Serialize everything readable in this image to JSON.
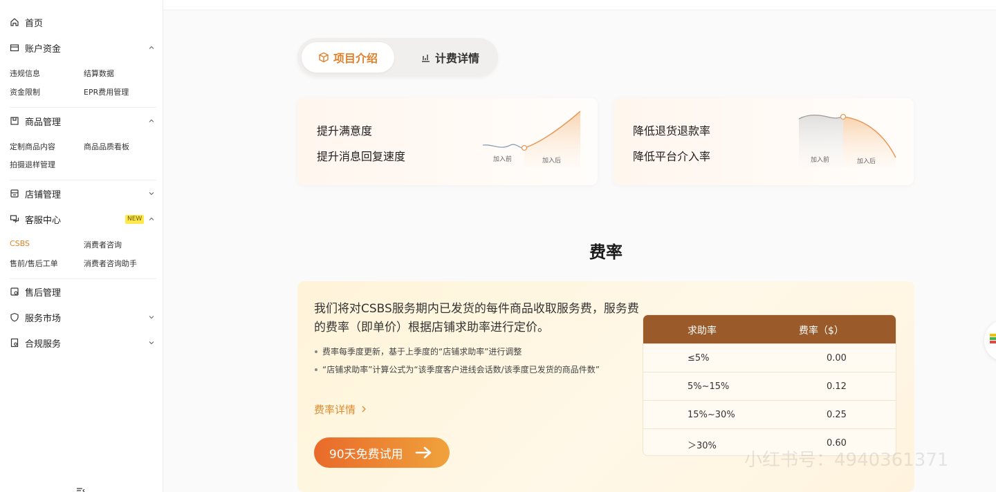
{
  "sidebar": {
    "home": "首页",
    "account": {
      "label": "账户资金",
      "items": [
        "违规信息",
        "结算数据",
        "资金限制",
        "EPR费用管理"
      ]
    },
    "goods": {
      "label": "商品管理",
      "items": [
        "定制商品内容",
        "商品品质看板",
        "拍摄退样管理"
      ]
    },
    "shop": {
      "label": "店铺管理"
    },
    "service": {
      "label": "客服中心",
      "badge": "NEW",
      "items": [
        "CSBS",
        "消费者咨询",
        "售前/售后工单",
        "消费者咨询助手"
      ]
    },
    "after_sales": {
      "label": "售后管理"
    },
    "market": {
      "label": "服务市场"
    },
    "compliance": {
      "label": "合规服务"
    }
  },
  "tabs": {
    "intro": "项目介绍",
    "billing": "计费详情"
  },
  "cards": [
    {
      "line1": "提升满意度",
      "line2": "提升消息回复速度",
      "before": "加入前",
      "after": "加入后"
    },
    {
      "line1": "降低退货退款率",
      "line2": "降低平台介入率",
      "before": "加入前",
      "after": "加入后"
    }
  ],
  "rate": {
    "title": "费率",
    "desc": "我们将对CSBS服务期内已发货的每件商品收取服务费，服务费的费率（即单价）根据店铺求助率进行定价。",
    "bullets": [
      "费率每季度更新，基于上季度的“店铺求助率”进行调整",
      "“店铺求助率”计算公式为“该季度客户进线会话数/该季度已发货的商品件数”"
    ],
    "detail_link": "费率详情",
    "trial_button": "90天免费试用",
    "table": {
      "headers": [
        "求助率",
        "费率（$）"
      ],
      "rows": [
        {
          "range": "≤5%",
          "fee": "0.00"
        },
        {
          "range": "5%~15%",
          "fee": "0.12"
        },
        {
          "range": "15%~30%",
          "fee": "0.25"
        },
        {
          "range": "＞30%",
          "fee": "0.60"
        }
      ]
    }
  },
  "watermark": "小红书号：4940361371",
  "colors": {
    "accent": "#e0802a",
    "table_header": "#9a5a2a",
    "button_start": "#e96a2a",
    "button_end": "#f0a23c"
  }
}
